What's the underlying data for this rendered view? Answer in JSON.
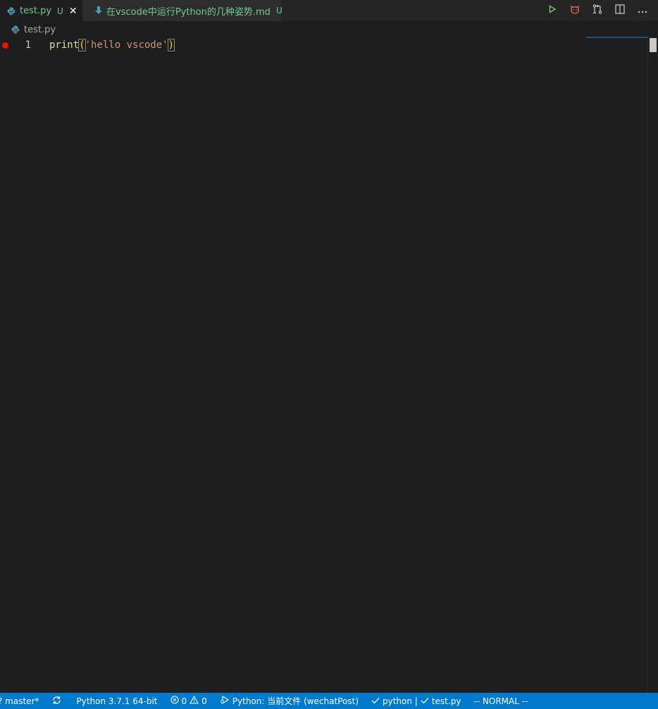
{
  "tabs": [
    {
      "label": "test.py",
      "status": "U",
      "icon": "python-file-icon",
      "active": true
    },
    {
      "label": "在vscode中运行Python的几种姿势.md",
      "status": "U",
      "icon": "markdown-file-icon",
      "active": false,
      "dirty": true
    }
  ],
  "breadcrumb": {
    "file": "test.py"
  },
  "editor": {
    "lines": [
      {
        "number": "1",
        "fn": "print",
        "open": "(",
        "str": "'hello vscode'",
        "close": ")"
      }
    ]
  },
  "statusbar": {
    "branch": "? master*",
    "interpreter": "Python 3.7.1 64-bit",
    "errors": "0",
    "warnings": "0",
    "run_config": "Python: 当前文件 (wechatPost)",
    "language_check": "python |",
    "file_check": "test.py",
    "vim_mode": "-- NORMAL --"
  },
  "colors": {
    "statusbar": "#007acc",
    "untracked": "#73c991",
    "breakpoint": "#e51400",
    "editor_bg": "#1e1e1e"
  }
}
